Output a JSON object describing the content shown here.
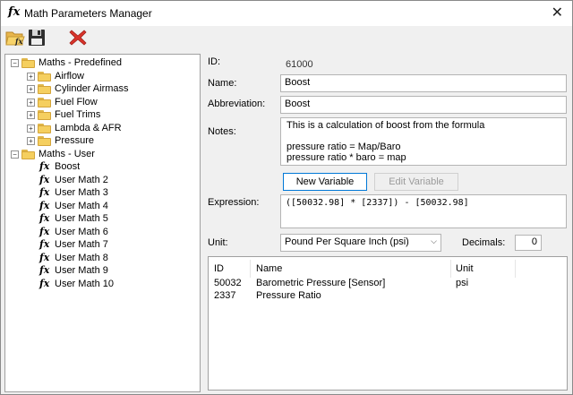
{
  "window": {
    "title": "Math Parameters Manager"
  },
  "tree": {
    "predefined": {
      "label": "Maths - Predefined",
      "children": [
        "Airflow",
        "Cylinder Airmass",
        "Fuel Flow",
        "Fuel Trims",
        "Lambda & AFR",
        "Pressure"
      ]
    },
    "user": {
      "label": "Maths - User",
      "children": [
        "Boost",
        "User Math 2",
        "User Math 3",
        "User Math 4",
        "User Math 5",
        "User Math 6",
        "User Math 7",
        "User Math 8",
        "User Math 9",
        "User Math 10"
      ]
    }
  },
  "form": {
    "id_label": "ID:",
    "id_value": "61000",
    "name_label": "Name:",
    "name_value": "Boost",
    "abbr_label": "Abbreviation:",
    "abbr_value": "Boost",
    "notes_label": "Notes:",
    "notes_lines": [
      "This is a calculation of boost from the formula",
      "",
      "pressure ratio = Map/Baro",
      "pressure ratio * baro = map"
    ],
    "new_variable": "New Variable",
    "edit_variable": "Edit Variable",
    "expression_label": "Expression:",
    "expression_value": "([50032.98] * [2337]) - [50032.98]",
    "unit_label": "Unit:",
    "unit_value": "Pound Per Square Inch (psi)",
    "decimals_label": "Decimals:",
    "decimals_value": "0"
  },
  "variables": {
    "headers": [
      "ID",
      "Name",
      "Unit"
    ],
    "rows": [
      [
        "50032",
        "Barometric Pressure [Sensor]",
        "psi"
      ],
      [
        "2337",
        "Pressure Ratio",
        ""
      ]
    ]
  },
  "colors": {
    "accent": "#0078d7",
    "folder": "#f5cf5f",
    "delete": "#d9342b"
  }
}
